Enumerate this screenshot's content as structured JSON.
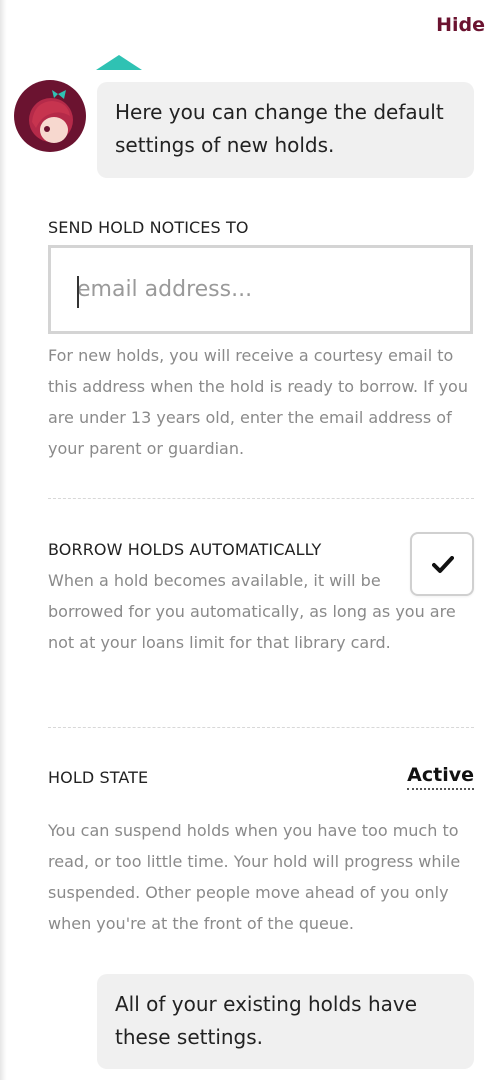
{
  "header": {
    "hide_label": "Hide"
  },
  "intro_bubble": {
    "text": "Here you can change the default settings of new holds."
  },
  "send_notices": {
    "label": "SEND HOLD NOTICES TO",
    "placeholder": "email address...",
    "value": "",
    "help": "For new holds, you will receive a courtesy email to this address when the hold is ready to borrow. If you are under 13 years old, enter the email address of your parent or guardian."
  },
  "borrow_auto": {
    "label": "BORROW HOLDS AUTOMATICALLY",
    "checked": true,
    "help": "When a hold becomes available, it will be borrowed for you automatically, as long as you are not at your loans limit for that library card."
  },
  "hold_state": {
    "label": "HOLD STATE",
    "value": "Active",
    "help": "You can suspend holds when you have too much to read, or too little time. Your hold will progress while suspended. Other people move ahead of you only when you're at the front of the queue."
  },
  "footer_bubble": {
    "text": "All of your existing holds have these settings."
  },
  "icons": {
    "avatar": "libby-avatar-icon",
    "checkmark": "checkmark-icon",
    "caret": "pointer-caret-icon"
  },
  "colors": {
    "accent_teal": "#2fc2b3",
    "brand_maroon": "#6b1330",
    "bubble_bg": "#f0f0f0",
    "help_text": "#8a8a8a"
  }
}
